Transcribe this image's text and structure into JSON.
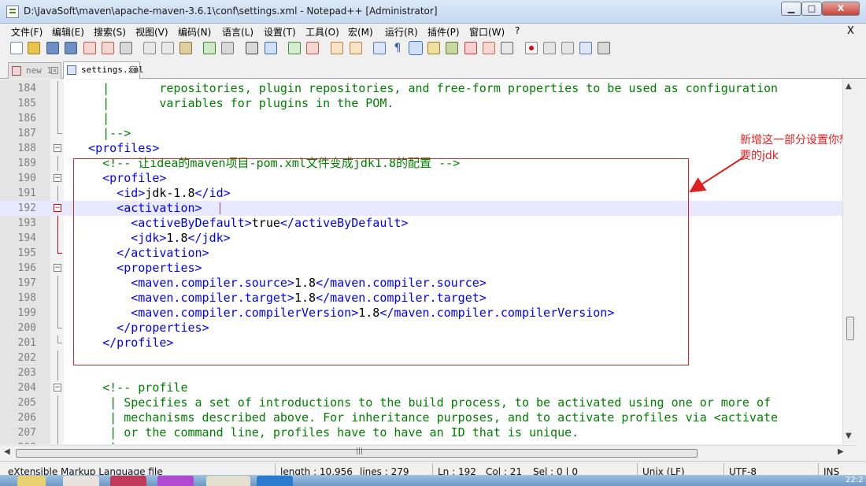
{
  "window": {
    "title": "D:\\JavaSoft\\maven\\apache-maven-3.6.1\\conf\\settings.xml - Notepad++ [Administrator]",
    "min_label": "▁",
    "max_label": "□",
    "close_label": "X"
  },
  "menu": {
    "items": [
      "文件(F)",
      "编辑(E)",
      "搜索(S)",
      "视图(V)",
      "编码(N)",
      "语言(L)",
      "设置(T)",
      "工具(O)",
      "宏(M)",
      "运行(R)",
      "插件(P)",
      "窗口(W)",
      "?"
    ],
    "close_doc": "X"
  },
  "toolbar": {
    "icons": [
      "new-icon",
      "open-icon",
      "save-icon",
      "save-all-icon",
      "close-icon",
      "close-all-icon",
      "print-icon",
      "cut-icon",
      "copy-icon",
      "paste-icon",
      "undo-icon",
      "redo-icon",
      "find-icon",
      "replace-icon",
      "zoom-in-icon",
      "zoom-out-icon",
      "sync-v-icon",
      "sync-h-icon",
      "wrap-icon",
      "show-all-chars-icon",
      "indent-guide-icon",
      "udl-icon",
      "doc-map-icon",
      "function-list-icon",
      "folder-workspace-icon",
      "monitor-icon",
      "record-macro-icon",
      "stop-macro-icon",
      "play-macro-icon",
      "run-macro-multiple-icon",
      "save-macro-icon"
    ]
  },
  "tabs": [
    {
      "label": "new 1",
      "close": "×"
    },
    {
      "label": "settings.xml",
      "close": "×"
    }
  ],
  "editor": {
    "lines": [
      {
        "num": "184",
        "code": "    |       repositories, plugin repositories, and free-form properties to be used as configuration",
        "kind": "comment"
      },
      {
        "num": "185",
        "code": "    |       variables for plugins in the POM.",
        "kind": "comment"
      },
      {
        "num": "186",
        "code": "    |",
        "kind": "comment"
      },
      {
        "num": "187",
        "code": "    |-->",
        "kind": "comment"
      },
      {
        "num": "188",
        "code": "  <profiles>",
        "kind": "tag"
      },
      {
        "num": "189",
        "code": "    <!-- 让idea的maven项目-pom.xml文件变成jdk1.8的配置 -->",
        "kind": "comment"
      },
      {
        "num": "190",
        "code": "    <profile>",
        "kind": "tag"
      },
      {
        "num": "191",
        "segments": [
          [
            "      <id>",
            "tag"
          ],
          [
            "jdk-1.8",
            "text"
          ],
          [
            "</id>",
            "tag"
          ]
        ]
      },
      {
        "num": "192",
        "code": "      <activation>",
        "kind": "tag"
      },
      {
        "num": "193",
        "segments": [
          [
            "        <activeByDefault>",
            "tag"
          ],
          [
            "true",
            "text"
          ],
          [
            "</activeByDefault>",
            "tag"
          ]
        ]
      },
      {
        "num": "194",
        "segments": [
          [
            "        <jdk>",
            "tag"
          ],
          [
            "1.8",
            "text"
          ],
          [
            "</jdk>",
            "tag"
          ]
        ]
      },
      {
        "num": "195",
        "code": "      </activation>",
        "kind": "tag"
      },
      {
        "num": "196",
        "code": "      <properties>",
        "kind": "tag"
      },
      {
        "num": "197",
        "segments": [
          [
            "        <maven.compiler.source>",
            "tag"
          ],
          [
            "1.8",
            "text"
          ],
          [
            "</maven.compiler.source>",
            "tag"
          ]
        ]
      },
      {
        "num": "198",
        "segments": [
          [
            "        <maven.compiler.target>",
            "tag"
          ],
          [
            "1.8",
            "text"
          ],
          [
            "</maven.compiler.target>",
            "tag"
          ]
        ]
      },
      {
        "num": "199",
        "segments": [
          [
            "        <maven.compiler.compilerVersion>",
            "tag"
          ],
          [
            "1.8",
            "text"
          ],
          [
            "</maven.compiler.compilerVersion>",
            "tag"
          ]
        ]
      },
      {
        "num": "200",
        "code": "      </properties>",
        "kind": "tag"
      },
      {
        "num": "201",
        "code": "    </profile>",
        "kind": "tag"
      },
      {
        "num": "202",
        "code": "",
        "kind": "text"
      },
      {
        "num": "203",
        "code": "",
        "kind": "text"
      },
      {
        "num": "204",
        "code": "    <!-- profile",
        "kind": "comment"
      },
      {
        "num": "205",
        "code": "     | Specifies a set of introductions to the build process, to be activated using one or more of",
        "kind": "comment"
      },
      {
        "num": "206",
        "code": "     | mechanisms described above. For inheritance purposes, and to activate profiles via <activate",
        "kind": "comment"
      },
      {
        "num": "207",
        "code": "     | or the command line, profiles have to have an ID that is unique.",
        "kind": "comment"
      },
      {
        "num": "208",
        "code": "     |",
        "kind": "comment"
      }
    ],
    "current_line": "192"
  },
  "annotation": {
    "text": "新增这一部分设置你想要的jdk",
    "color": "#e02020"
  },
  "status": {
    "file_type": "eXtensible Markup Language file",
    "length": "length : 10,956",
    "lines": "lines : 279",
    "ln": "Ln : 192",
    "col": "Col : 21",
    "sel": "Sel : 0 | 0",
    "eol": "Unix (LF)",
    "encoding": "UTF-8",
    "mode": "INS"
  },
  "taskbar": {
    "clock": "22:2"
  },
  "colors": {
    "comment": "#008000",
    "tag": "#0000ff",
    "text": "#000000",
    "current_line": "#e8e8ff",
    "annotation": "#e02020"
  }
}
